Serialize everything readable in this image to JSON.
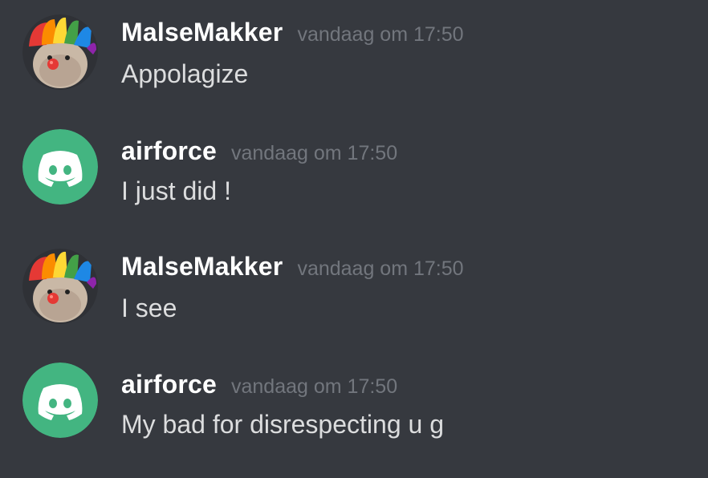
{
  "colors": {
    "background": "#36393f",
    "username": "#ffffff",
    "timestamp": "#72767d",
    "message_text": "#dcddde",
    "discord_avatar": "#43b581"
  },
  "messages": [
    {
      "author": "MalseMakker",
      "timestamp": "vandaag om 17:50",
      "text": "Appolagize",
      "avatar_icon": "clown-avatar-icon"
    },
    {
      "author": "airforce",
      "timestamp": "vandaag om 17:50",
      "text": "I just did !",
      "avatar_icon": "discord-logo-icon"
    },
    {
      "author": "MalseMakker",
      "timestamp": "vandaag om 17:50",
      "text": "I see",
      "avatar_icon": "clown-avatar-icon"
    },
    {
      "author": "airforce",
      "timestamp": "vandaag om 17:50",
      "text": "My bad for disrespecting u g",
      "avatar_icon": "discord-logo-icon"
    }
  ]
}
